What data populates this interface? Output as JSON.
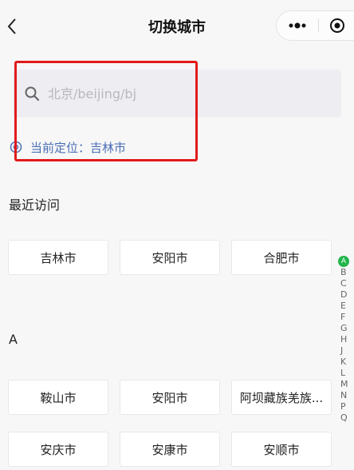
{
  "nav": {
    "title": "切换城市"
  },
  "search": {
    "placeholder": "北京/beijing/bj",
    "value": ""
  },
  "location": {
    "label": "当前定位：",
    "city": "吉林市"
  },
  "recent": {
    "title": "最近访问",
    "cities": [
      "吉林市",
      "安阳市",
      "合肥市"
    ]
  },
  "groups": [
    {
      "letter": "A",
      "cities": [
        "鞍山市",
        "安阳市",
        "阿坝藏族羌族...",
        "安庆市",
        "安康市",
        "安顺市"
      ]
    }
  ],
  "index": {
    "active": "A",
    "letters": [
      "A",
      "B",
      "C",
      "D",
      "E",
      "F",
      "G",
      "H",
      "J",
      "K",
      "L",
      "M",
      "N",
      "P",
      "Q"
    ]
  },
  "colors": {
    "accent_location": "#4a6fb5",
    "index_active": "#22b54a",
    "highlight_border": "#e11b1b"
  }
}
